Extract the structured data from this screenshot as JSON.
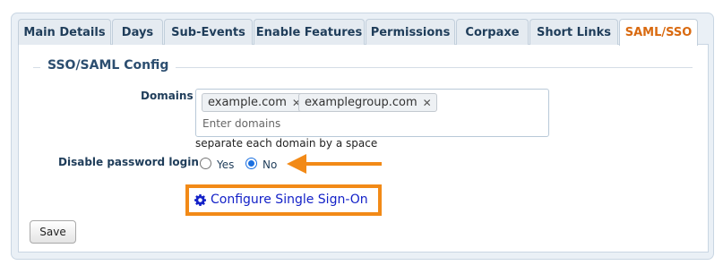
{
  "tabs": [
    {
      "label": "Main Details",
      "active": false
    },
    {
      "label": "Days",
      "active": false
    },
    {
      "label": "Sub-Events",
      "active": false
    },
    {
      "label": "Enable Features",
      "active": false
    },
    {
      "label": "Permissions",
      "active": false
    },
    {
      "label": "Corpaxe",
      "active": false
    },
    {
      "label": "Short Links",
      "active": false
    },
    {
      "label": "SAML/SSO",
      "active": true
    }
  ],
  "section": {
    "title": "SSO/SAML Config"
  },
  "domains": {
    "label": "Domains",
    "chips": [
      "example.com",
      "examplegroup.com"
    ],
    "placeholder": "Enter domains",
    "help": "separate each domain by a space"
  },
  "password_login": {
    "label": "Disable password login",
    "options": [
      {
        "label": "Yes",
        "checked": false
      },
      {
        "label": "No",
        "checked": true
      }
    ]
  },
  "sso": {
    "link_label": "Configure Single Sign-On",
    "icon": "gear-icon"
  },
  "actions": {
    "save_label": "Save"
  },
  "colors": {
    "highlight": "#f28a17",
    "active_tab": "#d96a10",
    "link": "#1422c8"
  }
}
